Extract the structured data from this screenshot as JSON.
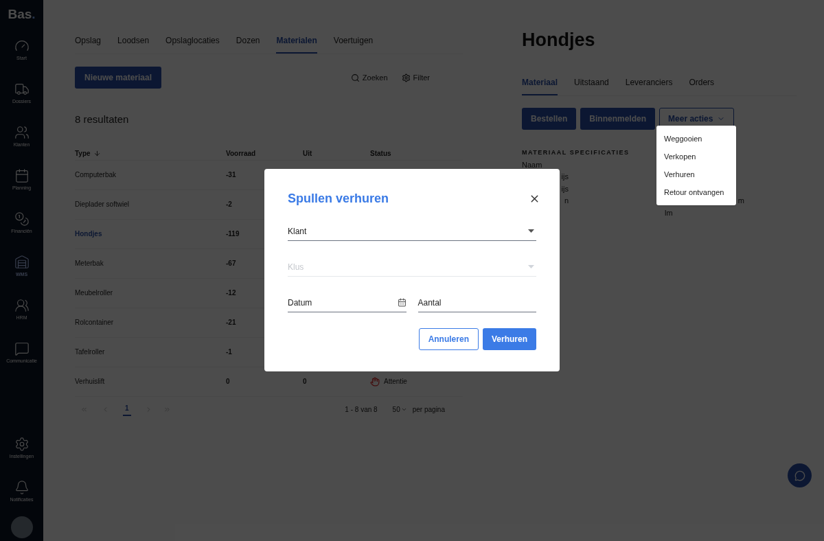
{
  "sidebar": {
    "logo": "Bas",
    "logo_dot": ".",
    "items": [
      {
        "label": "Start",
        "selected": false
      },
      {
        "label": "Dossiers",
        "selected": false
      },
      {
        "label": "Klanten",
        "selected": false
      },
      {
        "label": "Planning",
        "selected": false
      },
      {
        "label": "Financiën",
        "selected": false
      },
      {
        "label": "WMS",
        "selected": true
      },
      {
        "label": "HRM",
        "selected": false
      },
      {
        "label": "Communicatie",
        "selected": false
      }
    ],
    "bottom_items": [
      {
        "label": "Instellingen"
      },
      {
        "label": "Notificaties"
      }
    ]
  },
  "tabs": [
    {
      "label": "Opslag",
      "selected": false
    },
    {
      "label": "Loodsen",
      "selected": false
    },
    {
      "label": "Opslaglocaties",
      "selected": false
    },
    {
      "label": "Dozen",
      "selected": false
    },
    {
      "label": "Materialen",
      "selected": true
    },
    {
      "label": "Voertuigen",
      "selected": false
    }
  ],
  "new_button": "Nieuwe materiaal",
  "search_label": "Zoeken",
  "filter_label": "Filter",
  "results": "8 resultaten",
  "table": {
    "columns": [
      "Type",
      "Voorraad",
      "Uit",
      "Status"
    ],
    "rows": [
      {
        "type": "Computerbak",
        "selected": false,
        "voorraad": "-31"
      },
      {
        "type": "Dieplader softwiel",
        "selected": false,
        "voorraad": "-2"
      },
      {
        "type": "Hondjes",
        "selected": true,
        "voorraad": "-119"
      },
      {
        "type": "Meterbak",
        "selected": false,
        "voorraad": "-67"
      },
      {
        "type": "Meubelroller",
        "selected": false,
        "voorraad": "-12"
      },
      {
        "type": "Rolcontainer",
        "selected": false,
        "voorraad": "-21"
      },
      {
        "type": "Tafelroller",
        "selected": false,
        "voorraad": "-1"
      },
      {
        "type": "Verhuislift",
        "selected": false,
        "voorraad": "0",
        "uit": "0",
        "status": {
          "kind": "attention",
          "label": "Attentie"
        }
      }
    ]
  },
  "pagination": {
    "pages": [
      {
        "label": "1",
        "selected": true
      }
    ],
    "range": "1 - 8 van 8",
    "per_page": "50",
    "per_page_label": "per pagina"
  },
  "detail": {
    "title": "Hondjes",
    "tabs": [
      {
        "label": "Materiaal",
        "selected": true
      },
      {
        "label": "Uitstaand",
        "selected": false
      },
      {
        "label": "Leveranciers",
        "selected": false
      },
      {
        "label": "Orders",
        "selected": false
      }
    ],
    "actions": [
      "Bestellen",
      "Binnenmelden"
    ],
    "more_button": "Meer acties",
    "menu": [
      "Weggooien",
      "Verkopen",
      "Verhuren",
      "Retour ontvangen"
    ],
    "spec_heading": "MATERIAAL SPECIFICATIES",
    "specs": [
      {
        "label": "Naam"
      },
      {
        "label": "ijs"
      },
      {
        "label": "ijs"
      },
      {
        "label": "n",
        "value": "m"
      },
      {
        "value": "lm"
      }
    ]
  },
  "modal": {
    "title": "Spullen verhuren",
    "fields": [
      {
        "kind": "select",
        "label": "Klant",
        "disabled": false
      },
      {
        "kind": "select",
        "label": "Klus",
        "disabled": true
      },
      {
        "kind": "date",
        "label": "Datum",
        "disabled": false
      },
      {
        "kind": "text",
        "label": "Aantal",
        "disabled": false
      }
    ],
    "buttons": [
      {
        "kind": "secondary",
        "label": "Annuleren"
      },
      {
        "kind": "primary",
        "label": "Verhuren"
      }
    ]
  }
}
